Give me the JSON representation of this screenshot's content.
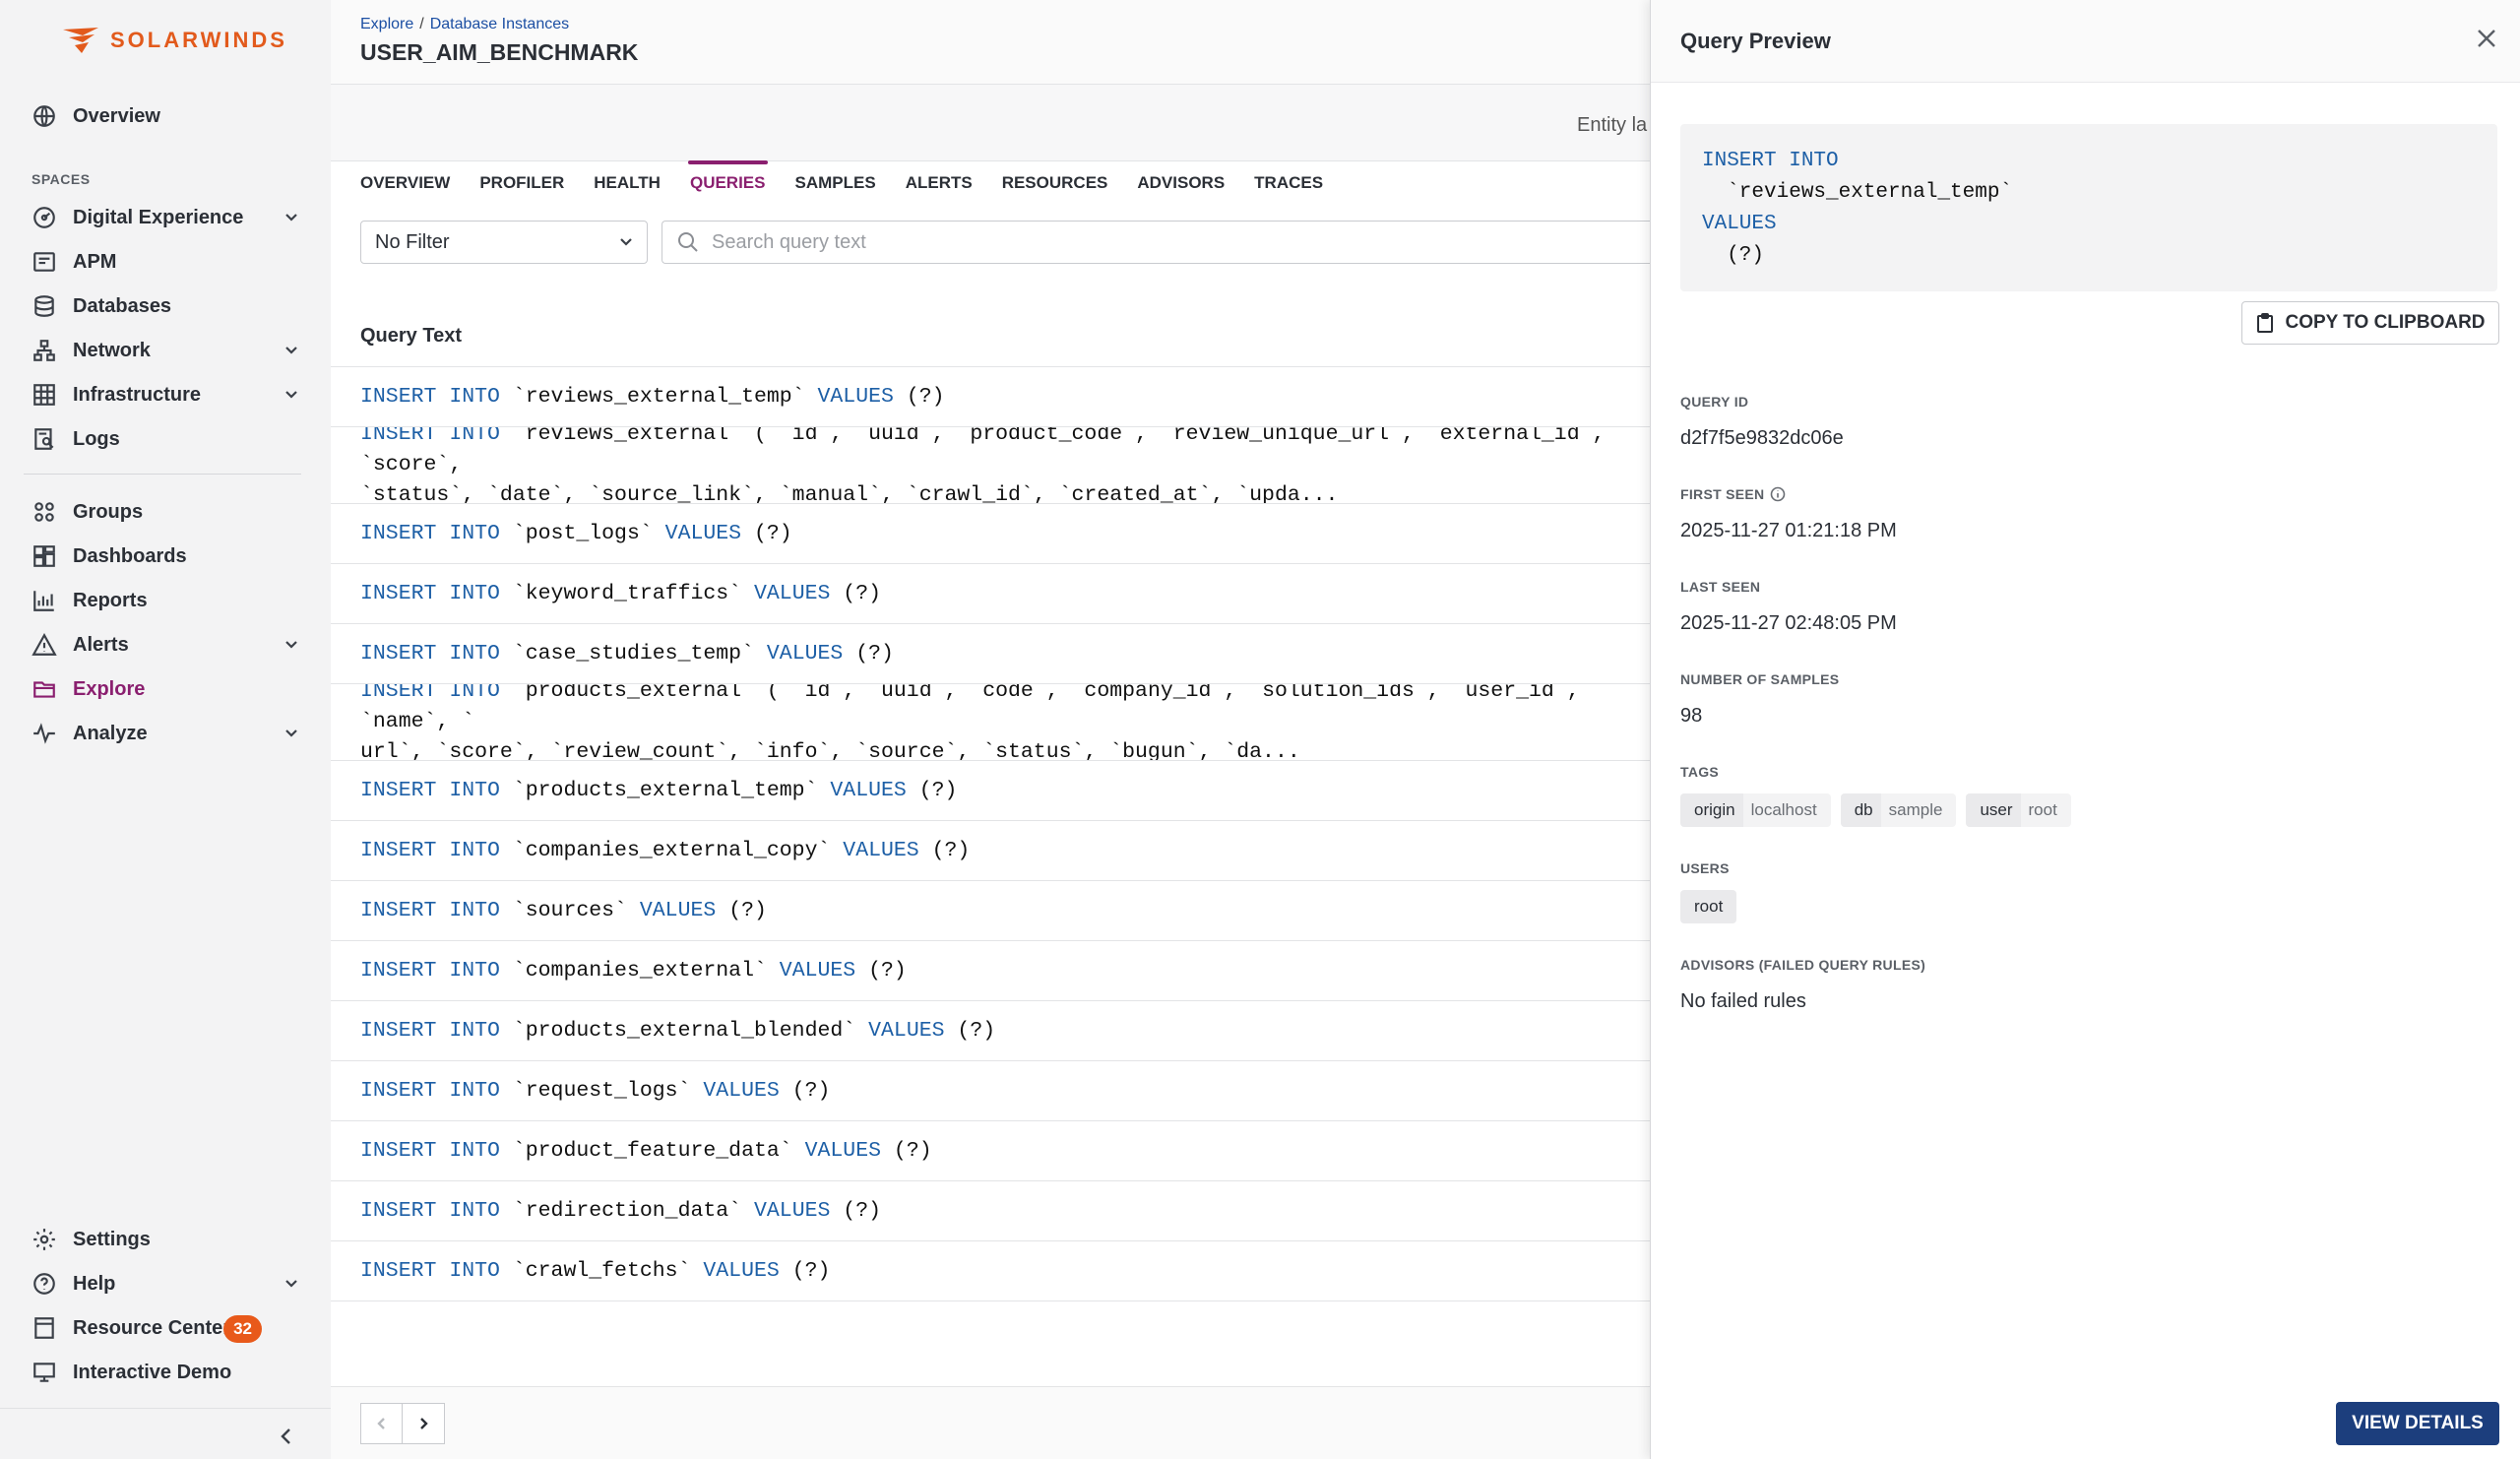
{
  "brand": {
    "name": "SOLARWINDS",
    "color": "#e25a1c"
  },
  "sidebar": {
    "top": [
      {
        "label": "Overview",
        "icon": "globe-icon"
      }
    ],
    "spaces_label": "SPACES",
    "spaces": [
      {
        "label": "Digital Experience",
        "icon": "dem-icon",
        "expandable": true
      },
      {
        "label": "APM",
        "icon": "apm-icon",
        "expandable": false
      },
      {
        "label": "Databases",
        "icon": "database-icon",
        "expandable": false
      },
      {
        "label": "Network",
        "icon": "network-icon",
        "expandable": true
      },
      {
        "label": "Infrastructure",
        "icon": "grid-icon",
        "expandable": true
      },
      {
        "label": "Logs",
        "icon": "logs-icon",
        "expandable": false
      }
    ],
    "tools": [
      {
        "label": "Groups",
        "icon": "groups-icon",
        "expandable": false
      },
      {
        "label": "Dashboards",
        "icon": "dashboards-icon",
        "expandable": false
      },
      {
        "label": "Reports",
        "icon": "reports-icon",
        "expandable": false
      },
      {
        "label": "Alerts",
        "icon": "alert-icon",
        "expandable": true
      },
      {
        "label": "Explore",
        "icon": "folder-icon",
        "expandable": false,
        "active": true
      },
      {
        "label": "Analyze",
        "icon": "pulse-icon",
        "expandable": true
      }
    ],
    "bottom": [
      {
        "label": "Settings",
        "icon": "gear-icon",
        "expandable": false
      },
      {
        "label": "Help",
        "icon": "help-icon",
        "expandable": true
      },
      {
        "label": "Resource Center",
        "icon": "resource-icon",
        "expandable": false,
        "badge": "32"
      },
      {
        "label": "Interactive Demo",
        "icon": "monitor-icon",
        "expandable": false
      }
    ],
    "active_color": "#8a1f6f",
    "badge_color": "#e8591a"
  },
  "header": {
    "breadcrumb": [
      "Explore",
      "Database Instances"
    ],
    "title": "USER_AIM_BENCHMARK",
    "entity_label": "Entity la"
  },
  "tabs": [
    "OVERVIEW",
    "PROFILER",
    "HEALTH",
    "QUERIES",
    "SAMPLES",
    "ALERTS",
    "RESOURCES",
    "ADVISORS",
    "TRACES"
  ],
  "active_tab": "QUERIES",
  "filter": {
    "selected": "No Filter"
  },
  "search": {
    "placeholder": "Search query text"
  },
  "table": {
    "column_header": "Query Text",
    "rows": [
      {
        "kw1": "INSERT INTO",
        "mid": " `reviews_external_temp` ",
        "kw2": "VALUES",
        "tail": " (?)"
      },
      {
        "kw1": "INSERT INTO",
        "mid": " `reviews_external` ( `id`, `uuid`, `product_code`, `review_unique_url`, `external_id`, `score`,\n`status`, `date`, `source_link`, `manual`, `crawl_id`, `created_at`, `upda...",
        "kw2": "",
        "tail": ""
      },
      {
        "kw1": "INSERT INTO",
        "mid": " `post_logs` ",
        "kw2": "VALUES",
        "tail": " (?)"
      },
      {
        "kw1": "INSERT INTO",
        "mid": " `keyword_traffics` ",
        "kw2": "VALUES",
        "tail": " (?)"
      },
      {
        "kw1": "INSERT INTO",
        "mid": " `case_studies_temp` ",
        "kw2": "VALUES",
        "tail": " (?)"
      },
      {
        "kw1": "INSERT INTO",
        "mid": " `products_external` ( `id`, `uuid`, `code`, `company_id`, `solution_ids`, `user_id`, `name`, `\nurl`, `score`, `review_count`, `info`, `source`, `status`, `bugun`, `da...",
        "kw2": "",
        "tail": ""
      },
      {
        "kw1": "INSERT INTO",
        "mid": " `products_external_temp` ",
        "kw2": "VALUES",
        "tail": " (?)"
      },
      {
        "kw1": "INSERT INTO",
        "mid": " `companies_external_copy` ",
        "kw2": "VALUES",
        "tail": " (?)"
      },
      {
        "kw1": "INSERT INTO",
        "mid": " `sources` ",
        "kw2": "VALUES",
        "tail": " (?)"
      },
      {
        "kw1": "INSERT INTO",
        "mid": " `companies_external` ",
        "kw2": "VALUES",
        "tail": " (?)"
      },
      {
        "kw1": "INSERT INTO",
        "mid": " `products_external_blended` ",
        "kw2": "VALUES",
        "tail": " (?)"
      },
      {
        "kw1": "INSERT INTO",
        "mid": " `request_logs` ",
        "kw2": "VALUES",
        "tail": " (?)"
      },
      {
        "kw1": "INSERT INTO",
        "mid": " `product_feature_data` ",
        "kw2": "VALUES",
        "tail": " (?)"
      },
      {
        "kw1": "INSERT INTO",
        "mid": " `redirection_data` ",
        "kw2": "VALUES",
        "tail": " (?)"
      },
      {
        "kw1": "INSERT INTO",
        "mid": " `crawl_fetchs` ",
        "kw2": "VALUES",
        "tail": " (?)"
      }
    ],
    "keyword_color": "#1d5fa6"
  },
  "preview": {
    "title": "Query Preview",
    "code": {
      "kw1": "INSERT INTO",
      "table": "  `reviews_external_temp`",
      "kw2": "VALUES",
      "params": "  (?)"
    },
    "copy_label": "COPY TO CLIPBOARD",
    "query_id_label": "QUERY ID",
    "query_id": "d2f7f5e9832dc06e",
    "first_seen_label": "FIRST SEEN",
    "first_seen": "2025-11-27 01:21:18 PM",
    "last_seen_label": "LAST SEEN",
    "last_seen": "2025-11-27 02:48:05 PM",
    "samples_label": "NUMBER OF SAMPLES",
    "samples": "98",
    "tags_label": "TAGS",
    "tags": [
      {
        "key": "origin",
        "value": "localhost"
      },
      {
        "key": "db",
        "value": "sample"
      },
      {
        "key": "user",
        "value": "root"
      }
    ],
    "users_label": "USERS",
    "users": [
      "root"
    ],
    "advisors_label": "ADVISORS (FAILED QUERY RULES)",
    "advisors_value": "No failed rules",
    "view_details_label": "VIEW DETAILS",
    "primary_color": "#1c3e7d"
  }
}
